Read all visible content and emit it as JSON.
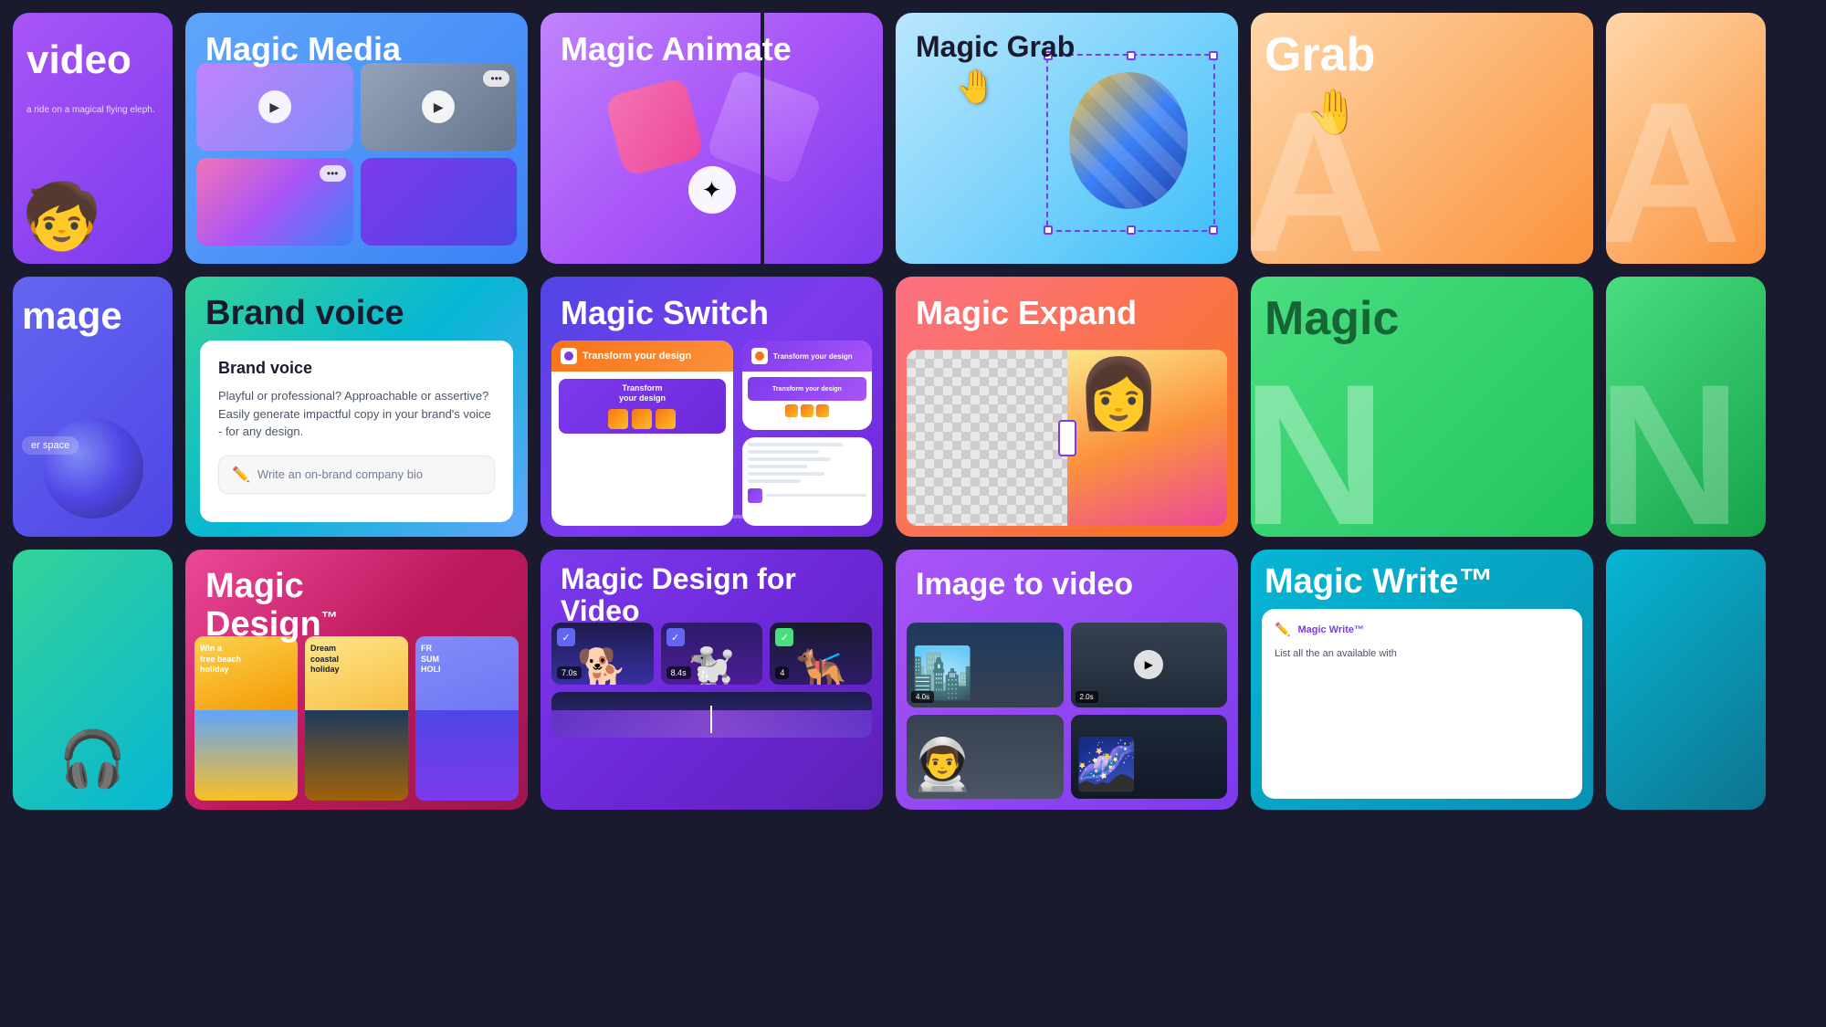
{
  "cards": {
    "video_partial": {
      "title": "video",
      "subtitle": "a ride on a magical flying eleph."
    },
    "magic_media": {
      "title": "Magic Media"
    },
    "magic_animate": {
      "title": "Magic Animate"
    },
    "magic_grab": {
      "title": "Magic Grab"
    },
    "grab_partial": {
      "title": "Grab"
    },
    "image_partial": {
      "title": "mage"
    },
    "brand_voice": {
      "title": "Brand voice",
      "subtitle_title": "Brand voice",
      "description": "Playful or professional? Approachable or assertive? Easily generate impactful copy in your brand's voice - for any design.",
      "input_placeholder": "Write an on-brand company bio"
    },
    "magic_switch": {
      "title": "Magic Switch",
      "panel1_title": "Transform your design",
      "panel2_title": "Transform your design",
      "panel3_title": "Transform your design"
    },
    "magic_expand": {
      "title": "Magic Expand"
    },
    "magic_right2": {
      "title": "Magic"
    },
    "gradient_partial": {},
    "magic_design": {
      "title": "Magic Design™",
      "thumb1_line1": "Win a",
      "thumb1_line2": "free beach",
      "thumb1_line3": "holiday",
      "thumb2_line1": "Dream",
      "thumb2_line2": "coastal",
      "thumb2_line3": "holiday",
      "thumb3_line1": "FR",
      "thumb3_line2": "SUM",
      "thumb3_line3": "HOLI"
    },
    "magic_design_video": {
      "title": "Magic Design for Video",
      "timer1": "7.0s",
      "timer2": "8.4s",
      "timer3": "4"
    },
    "image_to_video": {
      "title": "Image to video",
      "timer1": "4.0s",
      "timer2": "2.0s"
    },
    "magic_write": {
      "title": "Magic Write™",
      "logo_text": "Magic Write™",
      "body_text": "List all the an available with"
    }
  }
}
